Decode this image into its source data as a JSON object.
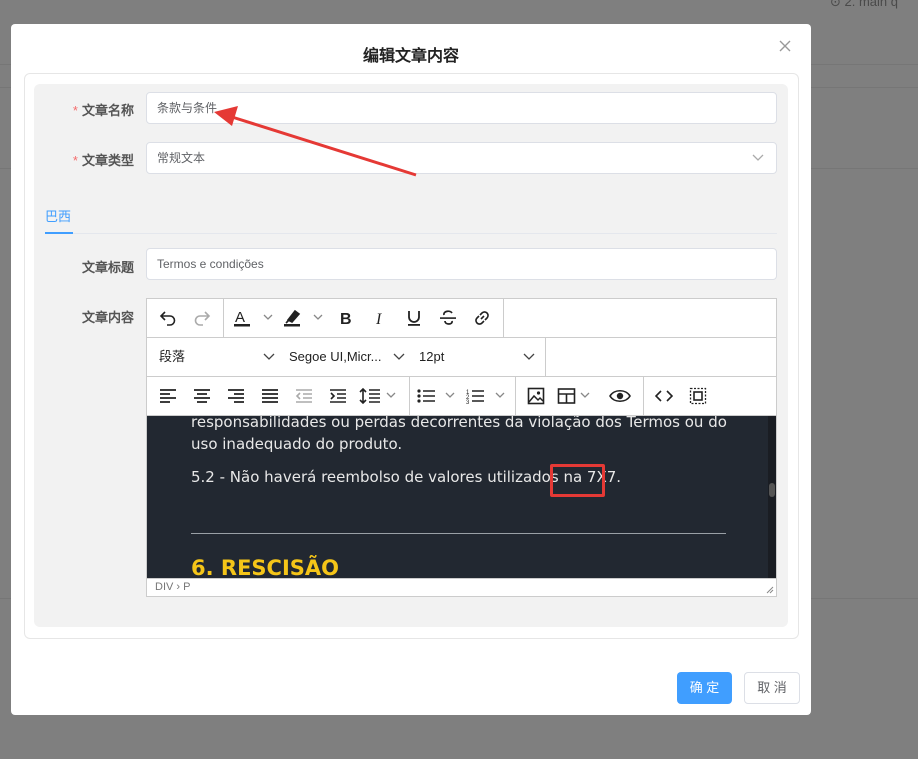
{
  "background": {
    "topright_text": "⊙  2. main q"
  },
  "modal": {
    "title": "编辑文章内容",
    "confirm_label": "确 定",
    "cancel_label": "取 消"
  },
  "form": {
    "required_mark": "*",
    "name_label": "文章名称",
    "name_value": "条款与条件",
    "type_label": "文章类型",
    "type_value": "常规文本",
    "tab_label": "巴西",
    "title_label": "文章标题",
    "title_value": "Termos e condições",
    "content_label": "文章内容"
  },
  "editor": {
    "block_format": "段落",
    "font_family": "Segoe UI,Micr...",
    "font_size": "12pt",
    "content": {
      "line1": "responsabilidades ou perdas decorrentes da violação dos Termos ou do",
      "line2": "uso inadequado do produto.",
      "line3": "5.2 - Não haverá reembolso de valores utilizados na 7X7.",
      "heading": "6. RESCISÃO"
    },
    "statusbar": "DIV › P"
  },
  "colors": {
    "primary": "#409eff",
    "required": "#f56c6c",
    "annotation_red": "#e53935",
    "editor_bg": "#222831",
    "heading_yellow": "#f5c518"
  }
}
